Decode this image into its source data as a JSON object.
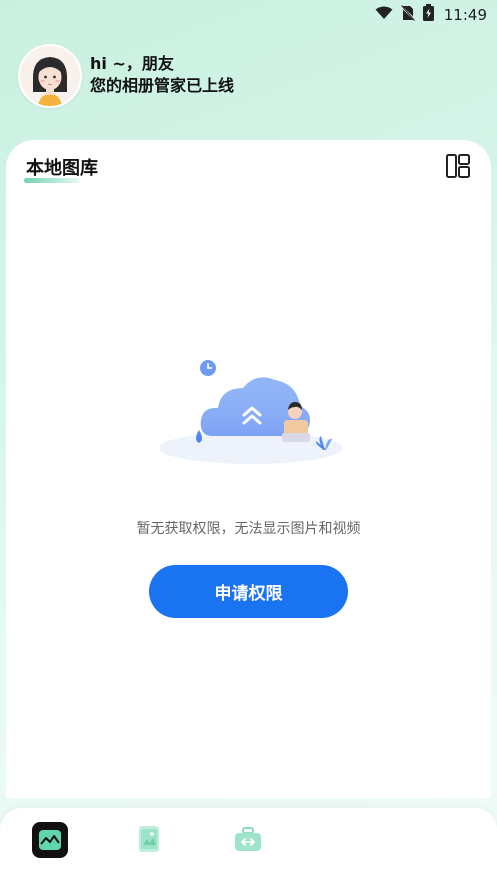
{
  "status_bar": {
    "time": "11:49"
  },
  "header": {
    "greeting_line1": "hi ~，朋友",
    "greeting_line2": "您的相册管家已上线"
  },
  "card": {
    "title": "本地图库",
    "empty_message": "暂无获取权限，无法显示图片和视频",
    "request_button_label": "申请权限"
  },
  "icons": {
    "wifi": "wifi-icon",
    "no_sim": "no-sim-icon",
    "battery": "battery-charging-icon",
    "layout_toggle": "grid-layout-icon",
    "nav_gallery": "gallery-icon",
    "nav_album": "album-icon",
    "nav_tools": "toolbox-icon"
  },
  "colors": {
    "accent": "#1a73f0",
    "brand_green": "#5fd1a8",
    "bg_top": "#c9f0df"
  }
}
